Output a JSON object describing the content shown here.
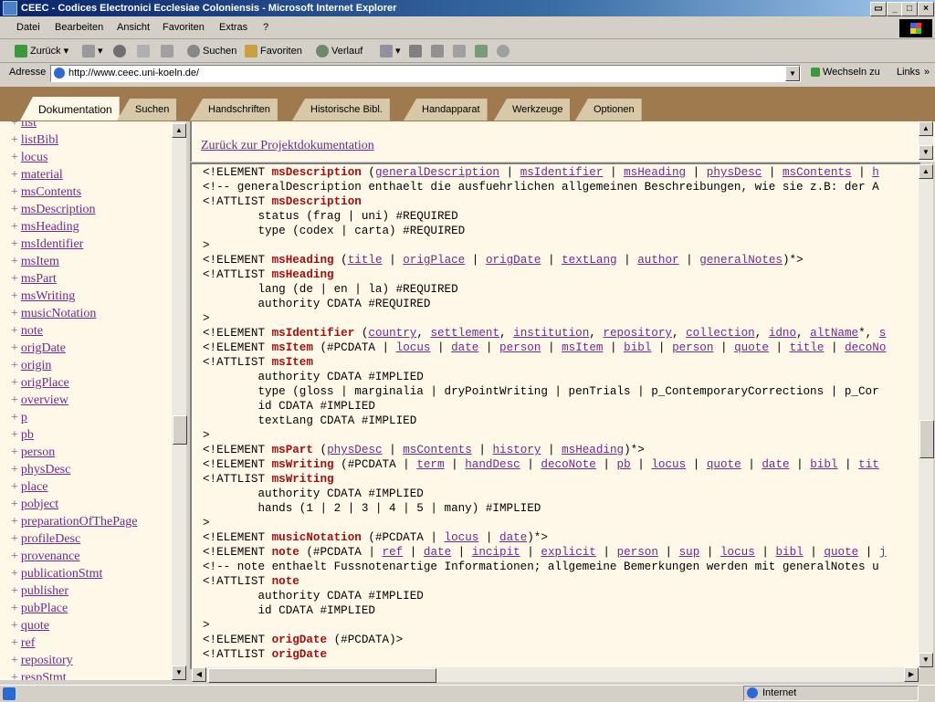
{
  "window": {
    "title": "CEEC - Codices Electronici Ecclesiae Coloniensis - Microsoft Internet Explorer"
  },
  "menu": [
    "Datei",
    "Bearbeiten",
    "Ansicht",
    "Favoriten",
    "Extras",
    "?"
  ],
  "toolbar": {
    "back": "Zurück",
    "search": "Suchen",
    "favorites": "Favoriten",
    "history": "Verlauf"
  },
  "address": {
    "label": "Adresse",
    "url": "http://www.ceec.uni-koeln.de/",
    "go": "Wechseln zu",
    "links": "Links"
  },
  "tabs": [
    "Dokumentation",
    "Suchen",
    "Handschriften",
    "Historische Bibl.",
    "Handapparat",
    "Werkzeuge",
    "Optionen"
  ],
  "left_items": [
    "list",
    "listBibl",
    "locus",
    "material",
    "msContents",
    "msDescription",
    "msHeading",
    "msIdentifier",
    "msItem",
    "msPart",
    "msWriting",
    "musicNotation",
    "note",
    "origDate",
    "origin",
    "origPlace",
    "overview",
    "p",
    "pb",
    "person",
    "physDesc",
    "place",
    "pobject",
    "preparationOfThePage",
    "profileDesc",
    "provenance",
    "publicationStmt",
    "publisher",
    "pubPlace",
    "quote",
    "ref",
    "repository",
    "respStmt"
  ],
  "left_plus": "+",
  "back_link": "Zurück zur Projektdokumentation",
  "code_lines": [
    [
      [
        "<!ELEMENT ",
        "t"
      ],
      [
        "msDescription",
        "k"
      ],
      [
        " (",
        "t"
      ],
      [
        "generalDescription",
        "l"
      ],
      [
        " | ",
        "t"
      ],
      [
        "msIdentifier",
        "l"
      ],
      [
        " | ",
        "t"
      ],
      [
        "msHeading",
        "l"
      ],
      [
        " | ",
        "t"
      ],
      [
        "physDesc",
        "l"
      ],
      [
        " | ",
        "t"
      ],
      [
        "msContents",
        "l"
      ],
      [
        " | ",
        "t"
      ],
      [
        "h",
        "l"
      ]
    ],
    [
      [
        "<!-- generalDescription enthaelt die ausfuehrlichen allgemeinen Beschreibungen, wie sie z.B: der A",
        "t"
      ]
    ],
    [
      [
        "<!ATTLIST ",
        "t"
      ],
      [
        "msDescription",
        "k"
      ]
    ],
    [
      [
        "        status (frag | uni) #REQUIRED",
        "t"
      ]
    ],
    [
      [
        "        type (codex | carta) #REQUIRED",
        "t"
      ]
    ],
    [
      [
        ">",
        "t"
      ]
    ],
    [
      [
        "<!ELEMENT ",
        "t"
      ],
      [
        "msHeading",
        "k"
      ],
      [
        " (",
        "t"
      ],
      [
        "title",
        "l"
      ],
      [
        " | ",
        "t"
      ],
      [
        "origPlace",
        "l"
      ],
      [
        " | ",
        "t"
      ],
      [
        "origDate",
        "l"
      ],
      [
        " | ",
        "t"
      ],
      [
        "textLang",
        "l"
      ],
      [
        " | ",
        "t"
      ],
      [
        "author",
        "l"
      ],
      [
        " | ",
        "t"
      ],
      [
        "generalNotes",
        "l"
      ],
      [
        ")*>",
        "t"
      ]
    ],
    [
      [
        "<!ATTLIST ",
        "t"
      ],
      [
        "msHeading",
        "k"
      ]
    ],
    [
      [
        "        lang (de | en | la) #REQUIRED",
        "t"
      ]
    ],
    [
      [
        "        authority CDATA #REQUIRED",
        "t"
      ]
    ],
    [
      [
        ">",
        "t"
      ]
    ],
    [
      [
        "<!ELEMENT ",
        "t"
      ],
      [
        "msIdentifier",
        "k"
      ],
      [
        " (",
        "t"
      ],
      [
        "country",
        "l"
      ],
      [
        ", ",
        "t"
      ],
      [
        "settlement",
        "l"
      ],
      [
        ", ",
        "t"
      ],
      [
        "institution",
        "l"
      ],
      [
        ", ",
        "t"
      ],
      [
        "repository",
        "l"
      ],
      [
        ", ",
        "t"
      ],
      [
        "collection",
        "l"
      ],
      [
        ", ",
        "t"
      ],
      [
        "idno",
        "l"
      ],
      [
        ", ",
        "t"
      ],
      [
        "altName",
        "l"
      ],
      [
        "*, ",
        "t"
      ],
      [
        "s",
        "l"
      ]
    ],
    [
      [
        "<!ELEMENT ",
        "t"
      ],
      [
        "msItem",
        "k"
      ],
      [
        " (#PCDATA | ",
        "t"
      ],
      [
        "locus",
        "l"
      ],
      [
        " | ",
        "t"
      ],
      [
        "date",
        "l"
      ],
      [
        " | ",
        "t"
      ],
      [
        "person",
        "l"
      ],
      [
        " | ",
        "t"
      ],
      [
        "msItem",
        "l"
      ],
      [
        " | ",
        "t"
      ],
      [
        "bibl",
        "l"
      ],
      [
        " | ",
        "t"
      ],
      [
        "person",
        "l"
      ],
      [
        " | ",
        "t"
      ],
      [
        "quote",
        "l"
      ],
      [
        " | ",
        "t"
      ],
      [
        "title",
        "l"
      ],
      [
        " | ",
        "t"
      ],
      [
        "decoNo",
        "l"
      ]
    ],
    [
      [
        "<!ATTLIST ",
        "t"
      ],
      [
        "msItem",
        "k"
      ]
    ],
    [
      [
        "        authority CDATA #IMPLIED",
        "t"
      ]
    ],
    [
      [
        "        type (gloss | marginalia | dryPointWriting | penTrials | p_ContemporaryCorrections | p_Cor",
        "t"
      ]
    ],
    [
      [
        "        id CDATA #IMPLIED",
        "t"
      ]
    ],
    [
      [
        "        textLang CDATA #IMPLIED",
        "t"
      ]
    ],
    [
      [
        ">",
        "t"
      ]
    ],
    [
      [
        "<!ELEMENT ",
        "t"
      ],
      [
        "msPart",
        "k"
      ],
      [
        " (",
        "t"
      ],
      [
        "physDesc",
        "l"
      ],
      [
        " | ",
        "t"
      ],
      [
        "msContents",
        "l"
      ],
      [
        " | ",
        "t"
      ],
      [
        "history",
        "l"
      ],
      [
        " | ",
        "t"
      ],
      [
        "msHeading",
        "l"
      ],
      [
        ")*>",
        "t"
      ]
    ],
    [
      [
        "<!ELEMENT ",
        "t"
      ],
      [
        "msWriting",
        "k"
      ],
      [
        " (#PCDATA | ",
        "t"
      ],
      [
        "term",
        "l"
      ],
      [
        " | ",
        "t"
      ],
      [
        "handDesc",
        "l"
      ],
      [
        " | ",
        "t"
      ],
      [
        "decoNote",
        "l"
      ],
      [
        " | ",
        "t"
      ],
      [
        "pb",
        "l"
      ],
      [
        " | ",
        "t"
      ],
      [
        "locus",
        "l"
      ],
      [
        " | ",
        "t"
      ],
      [
        "quote",
        "l"
      ],
      [
        " | ",
        "t"
      ],
      [
        "date",
        "l"
      ],
      [
        " | ",
        "t"
      ],
      [
        "bibl",
        "l"
      ],
      [
        " | ",
        "t"
      ],
      [
        "tit",
        "l"
      ]
    ],
    [
      [
        "<!ATTLIST ",
        "t"
      ],
      [
        "msWriting",
        "k"
      ]
    ],
    [
      [
        "        authority CDATA #IMPLIED",
        "t"
      ]
    ],
    [
      [
        "        hands (1 | 2 | 3 | 4 | 5 | many) #IMPLIED",
        "t"
      ]
    ],
    [
      [
        ">",
        "t"
      ]
    ],
    [
      [
        "<!ELEMENT ",
        "t"
      ],
      [
        "musicNotation",
        "k"
      ],
      [
        " (#PCDATA | ",
        "t"
      ],
      [
        "locus",
        "l"
      ],
      [
        " | ",
        "t"
      ],
      [
        "date",
        "l"
      ],
      [
        ")*>",
        "t"
      ]
    ],
    [
      [
        "<!ELEMENT ",
        "t"
      ],
      [
        "note",
        "k"
      ],
      [
        " (#PCDATA | ",
        "t"
      ],
      [
        "ref",
        "l"
      ],
      [
        " | ",
        "t"
      ],
      [
        "date",
        "l"
      ],
      [
        " | ",
        "t"
      ],
      [
        "incipit",
        "l"
      ],
      [
        " | ",
        "t"
      ],
      [
        "explicit",
        "l"
      ],
      [
        " | ",
        "t"
      ],
      [
        "person",
        "l"
      ],
      [
        " | ",
        "t"
      ],
      [
        "sup",
        "l"
      ],
      [
        " | ",
        "t"
      ],
      [
        "locus",
        "l"
      ],
      [
        " | ",
        "t"
      ],
      [
        "bibl",
        "l"
      ],
      [
        " | ",
        "t"
      ],
      [
        "quote",
        "l"
      ],
      [
        " | ",
        "t"
      ],
      [
        "j",
        "l"
      ]
    ],
    [
      [
        "<!-- note enthaelt Fussnotenartige Informationen; allgemeine Bemerkungen werden mit generalNotes u",
        "t"
      ]
    ],
    [
      [
        "<!ATTLIST ",
        "t"
      ],
      [
        "note",
        "k"
      ]
    ],
    [
      [
        "        authority CDATA #IMPLIED",
        "t"
      ]
    ],
    [
      [
        "        id CDATA #IMPLIED",
        "t"
      ]
    ],
    [
      [
        ">",
        "t"
      ]
    ],
    [
      [
        "<!ELEMENT ",
        "t"
      ],
      [
        "origDate",
        "k"
      ],
      [
        " (#PCDATA)>",
        "t"
      ]
    ],
    [
      [
        "<!ATTLIST ",
        "t"
      ],
      [
        "origDate",
        "k"
      ]
    ]
  ],
  "status": {
    "zone": "Internet"
  },
  "colors": {
    "keyword": "#a01010",
    "link": "#6b2c8e",
    "background": "#fff8e8",
    "band": "#9e7a4e"
  }
}
